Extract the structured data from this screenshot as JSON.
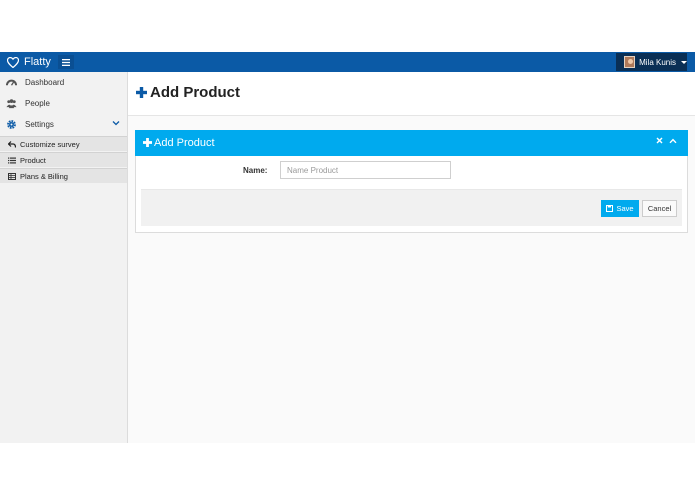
{
  "app": {
    "name": "Flatty"
  },
  "header": {
    "user_name": "Mila Kunis"
  },
  "sidebar": {
    "items": [
      {
        "label": "Dashboard",
        "icon": "dashboard-icon"
      },
      {
        "label": "People",
        "icon": "users-icon"
      },
      {
        "label": "Settings",
        "icon": "gear-icon"
      }
    ],
    "sub_items": [
      {
        "label": "Customize survey",
        "icon": "reply-icon"
      },
      {
        "label": "Product",
        "icon": "list-icon"
      },
      {
        "label": "Plans & Billing",
        "icon": "table-icon"
      }
    ]
  },
  "page": {
    "title": "Add Product"
  },
  "panel": {
    "title": "Add Product",
    "name_label": "Name:",
    "name_placeholder": "Name Product",
    "name_value": "",
    "save_label": "Save",
    "cancel_label": "Cancel"
  },
  "colors": {
    "topbar": "#0b5aa6",
    "accent": "#00aaee",
    "sidebar_bg": "#f2f2f2",
    "user_box": "#0a2f55"
  }
}
